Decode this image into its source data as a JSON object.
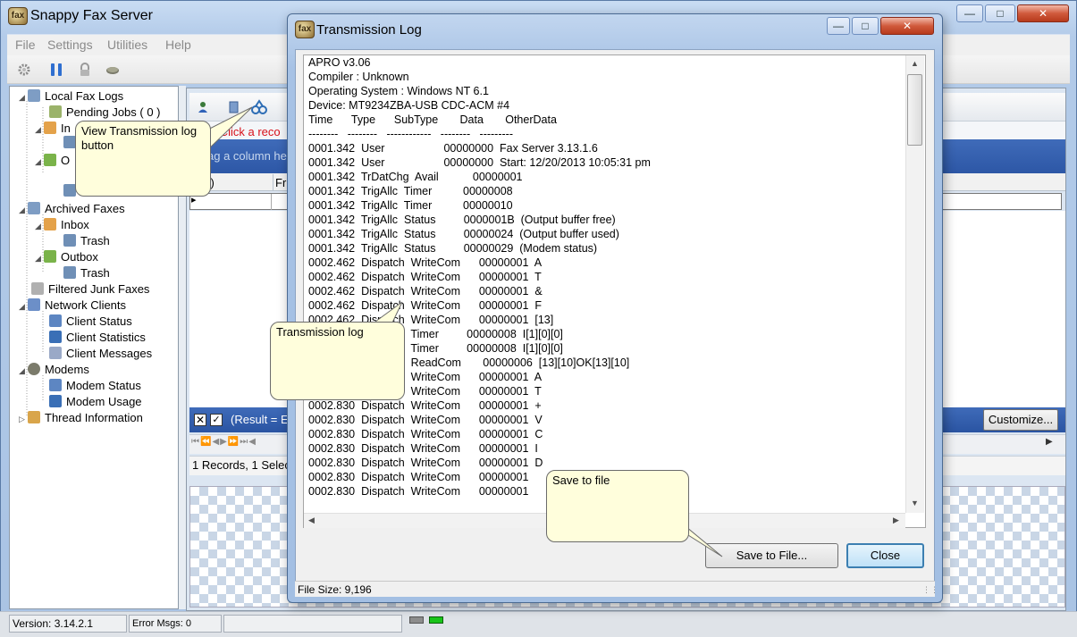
{
  "app": {
    "title": "Snappy Fax Server",
    "icon_text": "fax"
  },
  "caption_buttons": {
    "minimize": "—",
    "maximize": "□",
    "close": "✕"
  },
  "menu": [
    "File",
    "Settings",
    "Utilities",
    "Help"
  ],
  "toolbar_icons": [
    "gear-icon",
    "pause-icon",
    "lock-icon",
    "modem-icon"
  ],
  "tree": [
    {
      "label": "Local Fax Logs",
      "icon": "log-icon",
      "expander": "◢"
    },
    {
      "label": "Pending Jobs ( 0 )",
      "icon": "pending-icon"
    },
    {
      "label": "In",
      "icon": "inbox-icon",
      "expander": "◢"
    },
    {
      "label": "O",
      "icon": "outbox-icon",
      "expander": "◢"
    },
    {
      "label": "Archived Faxes",
      "icon": "archive-icon",
      "expander": "◢"
    },
    {
      "label": "Inbox",
      "icon": "inbox-icon",
      "expander": "◢"
    },
    {
      "label": "Trash",
      "icon": "trash-icon"
    },
    {
      "label": "Outbox",
      "icon": "outbox-icon",
      "expander": "◢"
    },
    {
      "label": "Trash",
      "icon": "trash-icon"
    },
    {
      "label": "Filtered Junk Faxes",
      "icon": "filter-icon"
    },
    {
      "label": "Network Clients",
      "icon": "network-icon",
      "expander": "◢"
    },
    {
      "label": "Client Status",
      "icon": "status-icon"
    },
    {
      "label": "Client Statistics",
      "icon": "statistics-icon"
    },
    {
      "label": "Client Messages",
      "icon": "messages-icon"
    },
    {
      "label": "Modems",
      "icon": "modem-icon",
      "expander": "◢"
    },
    {
      "label": "Modem  Status",
      "icon": "status-icon"
    },
    {
      "label": "Modem  Usage",
      "icon": "usage-icon"
    },
    {
      "label": "Thread Information",
      "icon": "thread-icon",
      "expander": "▷"
    }
  ],
  "grid": {
    "hint_text": "le Click a reco",
    "group_text": "ag a column he",
    "column_1": "(#)",
    "column_2": "Fr",
    "row_indicator": "▸",
    "filter_text": "(Result = E",
    "filter_x": "✕",
    "filter_check": "✓",
    "customize_label": "Customize...",
    "nav_buttons": "⏮⏪◀▶⏩⏭◀",
    "records_text": "1 Records, 1 Select"
  },
  "status_bar": {
    "version": "Version: 3.14.2.1",
    "errors": "Error Msgs: 0"
  },
  "dialog": {
    "title": "Transmission Log",
    "log_text": "APRO v3.06\nCompiler : Unknown\nOperating System : Windows NT 6.1\nDevice: MT9234ZBA-USB CDC-ACM #4\nTime      Type      SubType       Data       OtherData\n--------   --------   ------------   --------   ---------\n0001.342  User                   00000000  Fax Server 3.13.1.6\n0001.342  User                   00000000  Start: 12/20/2013 10:05:31 pm\n0001.342  TrDatChg  Avail           00000001\n0001.342  TrigAllc  Timer          00000008\n0001.342  TrigAllc  Timer          00000010\n0001.342  TrigAllc  Status         0000001B  (Output buffer free)\n0001.342  TrigAllc  Status         00000024  (Output buffer used)\n0001.342  TrigAllc  Status         00000029  (Modem status)\n0002.462  Dispatch  WriteCom      00000001  A\n0002.462  Dispatch  WriteCom      00000001  T\n0002.462  Dispatch  WriteCom      00000001  &\n0002.462  Dispatch  WriteCom      00000001  F\n0002.462  Dispatch  WriteCom      00000001  [13]\n0002.462  Dispatch  Timer         00000008  I[1][0][0]\n0002.462  Dispatch  Timer         00000008  I[1][0][0]\n0002.830  Dispatch  ReadCom       00000006  [13][10]OK[13][10]\n0002.830  Dispatch  WriteCom      00000001  A\n0002.830  Dispatch  WriteCom      00000001  T\n0002.830  Dispatch  WriteCom      00000001  +\n0002.830  Dispatch  WriteCom      00000001  V\n0002.830  Dispatch  WriteCom      00000001  C\n0002.830  Dispatch  WriteCom      00000001  I\n0002.830  Dispatch  WriteCom      00000001  D\n0002.830  Dispatch  WriteCom      00000001\n0002.830  Dispatch  WriteCom      00000001",
    "save_label": "Save to File...",
    "close_label": "Close",
    "file_size": "File Size: 9,196"
  },
  "callouts": {
    "view_log": "View Transmission log button",
    "transmission_log": "Transmission log",
    "save_to_file": "Save to file"
  },
  "colors": {
    "group_bar": "#2d57a6",
    "callout_bg": "#fffedc",
    "close_caption": "#c8452a"
  }
}
